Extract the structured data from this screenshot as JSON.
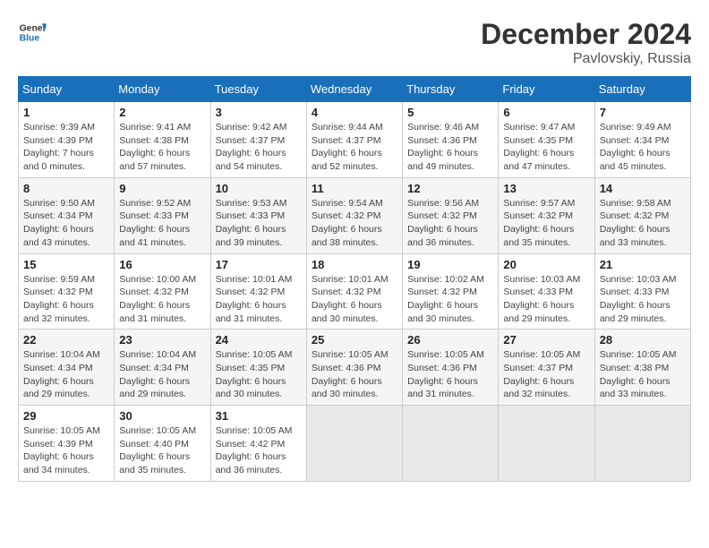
{
  "header": {
    "logo_line1": "General",
    "logo_line2": "Blue",
    "month": "December 2024",
    "location": "Pavlovskiy, Russia"
  },
  "weekdays": [
    "Sunday",
    "Monday",
    "Tuesday",
    "Wednesday",
    "Thursday",
    "Friday",
    "Saturday"
  ],
  "weeks": [
    [
      {
        "day": "1",
        "info": "Sunrise: 9:39 AM\nSunset: 4:39 PM\nDaylight: 7 hours\nand 0 minutes."
      },
      {
        "day": "2",
        "info": "Sunrise: 9:41 AM\nSunset: 4:38 PM\nDaylight: 6 hours\nand 57 minutes."
      },
      {
        "day": "3",
        "info": "Sunrise: 9:42 AM\nSunset: 4:37 PM\nDaylight: 6 hours\nand 54 minutes."
      },
      {
        "day": "4",
        "info": "Sunrise: 9:44 AM\nSunset: 4:37 PM\nDaylight: 6 hours\nand 52 minutes."
      },
      {
        "day": "5",
        "info": "Sunrise: 9:46 AM\nSunset: 4:36 PM\nDaylight: 6 hours\nand 49 minutes."
      },
      {
        "day": "6",
        "info": "Sunrise: 9:47 AM\nSunset: 4:35 PM\nDaylight: 6 hours\nand 47 minutes."
      },
      {
        "day": "7",
        "info": "Sunrise: 9:49 AM\nSunset: 4:34 PM\nDaylight: 6 hours\nand 45 minutes."
      }
    ],
    [
      {
        "day": "8",
        "info": "Sunrise: 9:50 AM\nSunset: 4:34 PM\nDaylight: 6 hours\nand 43 minutes."
      },
      {
        "day": "9",
        "info": "Sunrise: 9:52 AM\nSunset: 4:33 PM\nDaylight: 6 hours\nand 41 minutes."
      },
      {
        "day": "10",
        "info": "Sunrise: 9:53 AM\nSunset: 4:33 PM\nDaylight: 6 hours\nand 39 minutes."
      },
      {
        "day": "11",
        "info": "Sunrise: 9:54 AM\nSunset: 4:32 PM\nDaylight: 6 hours\nand 38 minutes."
      },
      {
        "day": "12",
        "info": "Sunrise: 9:56 AM\nSunset: 4:32 PM\nDaylight: 6 hours\nand 36 minutes."
      },
      {
        "day": "13",
        "info": "Sunrise: 9:57 AM\nSunset: 4:32 PM\nDaylight: 6 hours\nand 35 minutes."
      },
      {
        "day": "14",
        "info": "Sunrise: 9:58 AM\nSunset: 4:32 PM\nDaylight: 6 hours\nand 33 minutes."
      }
    ],
    [
      {
        "day": "15",
        "info": "Sunrise: 9:59 AM\nSunset: 4:32 PM\nDaylight: 6 hours\nand 32 minutes."
      },
      {
        "day": "16",
        "info": "Sunrise: 10:00 AM\nSunset: 4:32 PM\nDaylight: 6 hours\nand 31 minutes."
      },
      {
        "day": "17",
        "info": "Sunrise: 10:01 AM\nSunset: 4:32 PM\nDaylight: 6 hours\nand 31 minutes."
      },
      {
        "day": "18",
        "info": "Sunrise: 10:01 AM\nSunset: 4:32 PM\nDaylight: 6 hours\nand 30 minutes."
      },
      {
        "day": "19",
        "info": "Sunrise: 10:02 AM\nSunset: 4:32 PM\nDaylight: 6 hours\nand 30 minutes."
      },
      {
        "day": "20",
        "info": "Sunrise: 10:03 AM\nSunset: 4:33 PM\nDaylight: 6 hours\nand 29 minutes."
      },
      {
        "day": "21",
        "info": "Sunrise: 10:03 AM\nSunset: 4:33 PM\nDaylight: 6 hours\nand 29 minutes."
      }
    ],
    [
      {
        "day": "22",
        "info": "Sunrise: 10:04 AM\nSunset: 4:34 PM\nDaylight: 6 hours\nand 29 minutes."
      },
      {
        "day": "23",
        "info": "Sunrise: 10:04 AM\nSunset: 4:34 PM\nDaylight: 6 hours\nand 29 minutes."
      },
      {
        "day": "24",
        "info": "Sunrise: 10:05 AM\nSunset: 4:35 PM\nDaylight: 6 hours\nand 30 minutes."
      },
      {
        "day": "25",
        "info": "Sunrise: 10:05 AM\nSunset: 4:36 PM\nDaylight: 6 hours\nand 30 minutes."
      },
      {
        "day": "26",
        "info": "Sunrise: 10:05 AM\nSunset: 4:36 PM\nDaylight: 6 hours\nand 31 minutes."
      },
      {
        "day": "27",
        "info": "Sunrise: 10:05 AM\nSunset: 4:37 PM\nDaylight: 6 hours\nand 32 minutes."
      },
      {
        "day": "28",
        "info": "Sunrise: 10:05 AM\nSunset: 4:38 PM\nDaylight: 6 hours\nand 33 minutes."
      }
    ],
    [
      {
        "day": "29",
        "info": "Sunrise: 10:05 AM\nSunset: 4:39 PM\nDaylight: 6 hours\nand 34 minutes."
      },
      {
        "day": "30",
        "info": "Sunrise: 10:05 AM\nSunset: 4:40 PM\nDaylight: 6 hours\nand 35 minutes."
      },
      {
        "day": "31",
        "info": "Sunrise: 10:05 AM\nSunset: 4:42 PM\nDaylight: 6 hours\nand 36 minutes."
      },
      null,
      null,
      null,
      null
    ]
  ]
}
